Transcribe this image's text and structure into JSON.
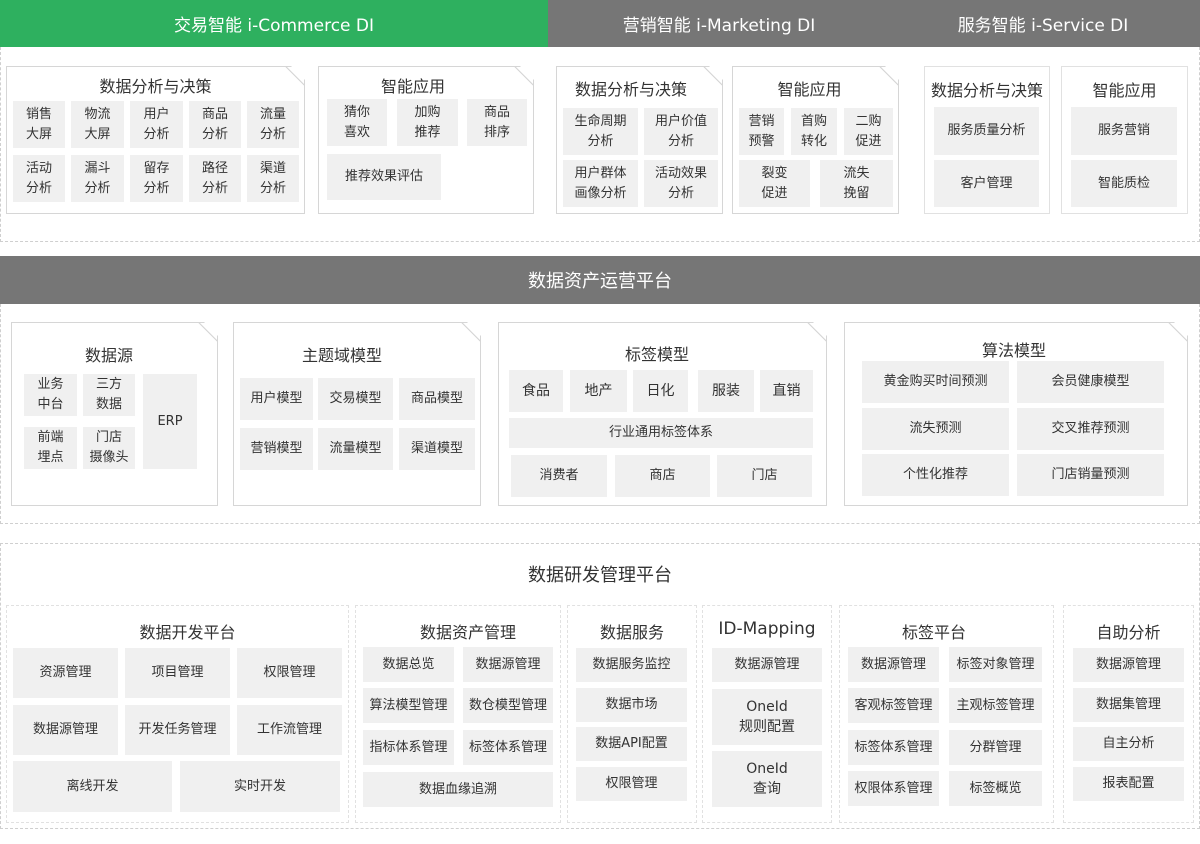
{
  "tabs": {
    "commerce": "交易智能 i-Commerce DI",
    "marketing": "营销智能 i-Marketing DI",
    "service": "服务智能 i-Service DI"
  },
  "colors": {
    "green": "#2eb05f",
    "gray": "#767676",
    "box": "#f0f0f0"
  },
  "commerce": {
    "analysis": {
      "title": "数据分析与决策",
      "items": [
        "销售\n大屏",
        "物流\n大屏",
        "用户\n分析",
        "商品\n分析",
        "流量\n分析",
        "活动\n分析",
        "漏斗\n分析",
        "留存\n分析",
        "路径\n分析",
        "渠道\n分析"
      ]
    },
    "apps": {
      "title": "智能应用",
      "items": [
        "猜你\n喜欢",
        "加购\n推荐",
        "商品\n排序",
        "推荐效果评估"
      ]
    }
  },
  "marketing": {
    "analysis": {
      "title": "数据分析与决策",
      "items": [
        "生命周期\n分析",
        "用户价值\n分析",
        "用户群体\n画像分析",
        "活动效果\n分析"
      ]
    },
    "apps": {
      "title": "智能应用",
      "items": [
        "营销\n预警",
        "首购\n转化",
        "二购\n促进",
        "裂变\n促进",
        "流失\n挽留"
      ]
    }
  },
  "service": {
    "analysis": {
      "title": "数据分析与决策",
      "items": [
        "服务质量分析",
        "客户管理"
      ]
    },
    "apps": {
      "title": "智能应用",
      "items": [
        "服务营销",
        "智能质检"
      ]
    }
  },
  "asset_platform": {
    "title": "数据资产运营平台",
    "source": {
      "title": "数据源",
      "items": [
        "业务\n中台",
        "三方\n数据",
        "前端\n埋点",
        "门店\n摄像头",
        "ERP"
      ]
    },
    "topic": {
      "title": "主题域模型",
      "items": [
        "用户模型",
        "交易模型",
        "商品模型",
        "营销模型",
        "流量模型",
        "渠道模型"
      ]
    },
    "tag": {
      "title": "标签模型",
      "items": [
        "食品",
        "地产",
        "日化",
        "服装",
        "直销",
        "行业通用标签体系",
        "消费者",
        "商店",
        "门店"
      ]
    },
    "algo": {
      "title": "算法模型",
      "items": [
        "黄金购买时间预测",
        "会员健康模型",
        "流失预测",
        "交叉推荐预测",
        "个性化推荐",
        "门店销量预测"
      ]
    }
  },
  "rd_platform": {
    "title": "数据研发管理平台",
    "dev": {
      "title": "数据开发平台",
      "items": [
        "资源管理",
        "项目管理",
        "权限管理",
        "数据源管理",
        "开发任务管理",
        "工作流管理",
        "离线开发",
        "实时开发"
      ]
    },
    "asset": {
      "title": "数据资产管理",
      "items": [
        "数据总览",
        "数据源管理",
        "算法模型管理",
        "数仓模型管理",
        "指标体系管理",
        "标签体系管理",
        "数据血缘追溯"
      ]
    },
    "service": {
      "title": "数据服务",
      "items": [
        "数据服务监控",
        "数据市场",
        "数据API配置",
        "权限管理"
      ]
    },
    "idmap": {
      "title": "ID-Mapping",
      "items": [
        "数据源管理",
        "OneId\n规则配置",
        "OneId\n查询"
      ]
    },
    "tagp": {
      "title": "标签平台",
      "items": [
        "数据源管理",
        "标签对象管理",
        "客观标签管理",
        "主观标签管理",
        "标签体系管理",
        "分群管理",
        "权限体系管理",
        "标签概览"
      ]
    },
    "self": {
      "title": "自助分析",
      "items": [
        "数据源管理",
        "数据集管理",
        "自主分析",
        "报表配置"
      ]
    }
  }
}
